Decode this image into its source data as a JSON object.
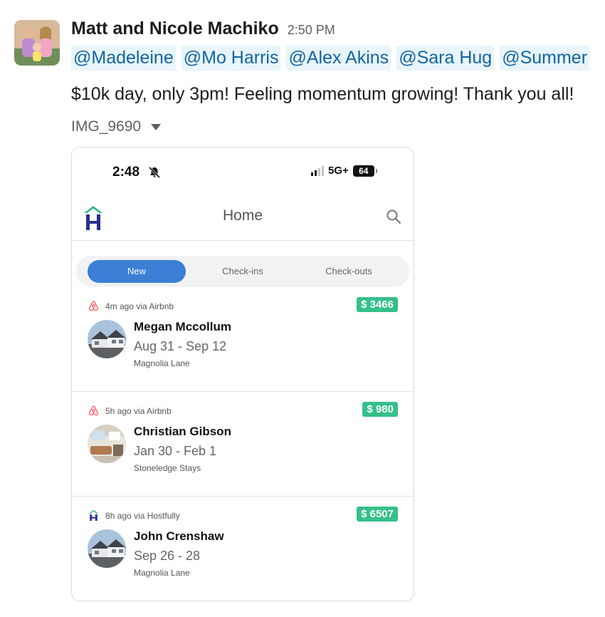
{
  "message": {
    "sender": "Matt and Nicole Machiko",
    "time": "2:50 PM",
    "mentions": [
      "@Madeleine",
      "@Mo Harris",
      "@Alex Akins",
      "@Sara Hug",
      "@Summer"
    ],
    "text": "$10k day, only 3pm! Feeling momentum growing! Thank you all!",
    "attachment_name": "IMG_9690"
  },
  "phone": {
    "status_time": "2:48",
    "network": "5G+",
    "battery": "64",
    "screen_title": "Home",
    "tabs": [
      "New",
      "Check-ins",
      "Check-outs"
    ],
    "active_tab": "New",
    "bookings": [
      {
        "source_icon": "airbnb-icon",
        "source": "4m ago via Airbnb",
        "price": "$ 3466",
        "guest": "Megan Mccollum",
        "dates": "Aug 31 - Sep 12",
        "property": "Magnolia Lane"
      },
      {
        "source_icon": "airbnb-icon",
        "source": "5h ago via Airbnb",
        "price": "$ 980",
        "guest": "Christian Gibson",
        "dates": "Jan 30 - Feb 1",
        "property": "Stoneledge Stays"
      },
      {
        "source_icon": "hostfully-icon",
        "source": "8h ago via Hostfully",
        "price": "$ 6507",
        "guest": "John Crenshaw",
        "dates": "Sep 26 - 28",
        "property": "Magnolia Lane"
      }
    ]
  },
  "colors": {
    "mention_bg": "#e8f5fa",
    "mention_text": "#1264a3",
    "active_tab": "#3b7fd6",
    "price_badge": "#34c08b",
    "airbnb": "#ff5a5f",
    "brand_navy": "#2a2f8f",
    "brand_teal": "#2fb38a"
  }
}
